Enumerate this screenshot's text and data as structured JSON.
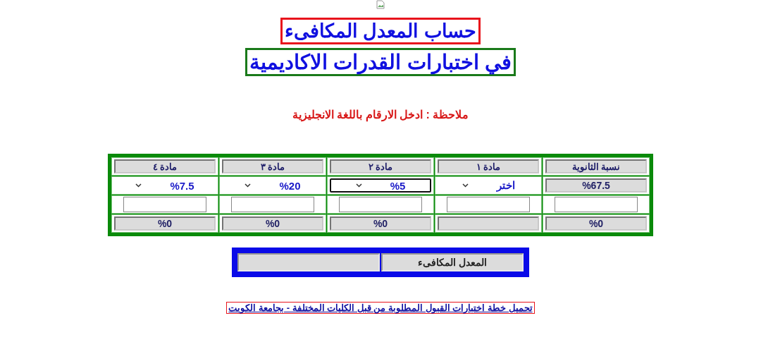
{
  "title": "حساب المعدل المكافىء",
  "subtitle": "في اختبارات القدرات الاكاديمية",
  "note": "ملاحظة : ادخل الارقام باللغة الانجليزية",
  "columns": [
    {
      "header": "نسبة الثانوية",
      "kind": "readout",
      "value": "%67.5",
      "result": "%0"
    },
    {
      "header": "مادة ١",
      "kind": "select",
      "value": "اختر",
      "focused": false
    },
    {
      "header": "مادة ٢",
      "kind": "select",
      "value": "%5",
      "focused": true,
      "result": "%0"
    },
    {
      "header": "مادة ٣",
      "kind": "select",
      "value": "%20",
      "focused": false,
      "result": "%0"
    },
    {
      "header": "مادة ٤",
      "kind": "select",
      "value": "%7.5",
      "focused": false,
      "result": "%0"
    }
  ],
  "equivalent": {
    "label": "المعدل المكافىء"
  },
  "link": "تحميل خطة اختبارات القبول المطلوبة من قبل الكليات المختلفة - بجامعة الكويت"
}
